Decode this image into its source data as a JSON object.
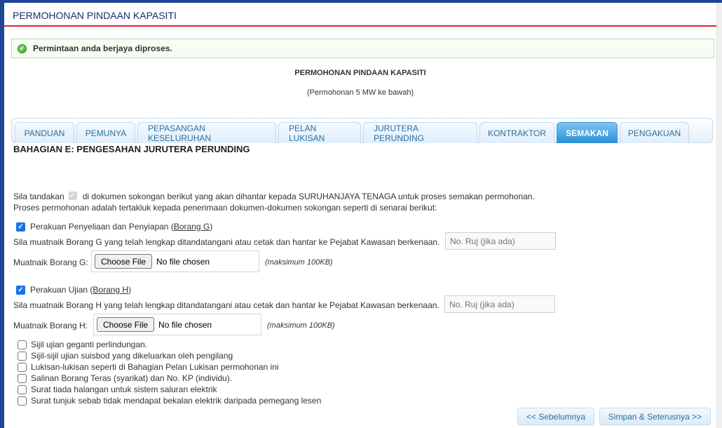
{
  "page": {
    "header_title": "PERMOHONAN PINDAAN KAPASITI"
  },
  "alert": {
    "icon": "success-check-icon",
    "message": "Permintaan anda berjaya diproses.",
    "color": "#3d9c2e"
  },
  "form": {
    "title": "PERMOHONAN PINDAAN KAPASITI",
    "subtitle": "(Permohonan 5 MW ke bawah)"
  },
  "tabs": [
    {
      "label": "PANDUAN",
      "active": false
    },
    {
      "label": "PEMUNYA",
      "active": false
    },
    {
      "label": "PEPASANGAN KESELURUHAN",
      "active": false
    },
    {
      "label": "PELAN LUKISAN",
      "active": false
    },
    {
      "label": "JURUTERA PERUNDING",
      "active": false
    },
    {
      "label": "KONTRAKTOR",
      "active": false
    },
    {
      "label": "SEMAKAN",
      "active": true
    },
    {
      "label": "PENGAKUAN",
      "active": false
    }
  ],
  "section": {
    "title": "BAHAGIAN E: PENGESAHAN JURUTERA PERUNDING",
    "intro_before": "Sila tandakan",
    "intro_after": "di dokumen sokongan berikut yang akan dihantar kepada SURUHANJAYA TENAGA untuk proses semakan permohonan.",
    "intro_line2": "Proses permohonan adalah tertakluk kepada penerimaan dokumen-dokumen sokongan seperti di senarai berikut:"
  },
  "borang_g": {
    "checked": true,
    "label_before": "Perakuan Penyeliaan dan Penyiapan (",
    "link": "Borang G",
    "label_after": ")",
    "instruction": "Sila muatnaik Borang G yang telah lengkap ditandatangani atau cetak dan hantar ke Pejabat Kawasan berkenaan.",
    "ruj_placeholder": "No. Ruj (jika ada)",
    "ruj_value": "",
    "upload_label": "Muatnaik Borang G:",
    "file_button": "Choose File",
    "file_status": "No file chosen",
    "max_note": "(maksimum 100KB)"
  },
  "borang_h": {
    "checked": true,
    "label_before": "Perakuan Ujian (",
    "link": "Borang H",
    "label_after": ")",
    "instruction": "Sila muatnaik Borang H yang telah lengkap ditandatangani atau cetak dan hantar ke Pejabat Kawasan berkenaan.",
    "ruj_placeholder": "No. Ruj (jika ada)",
    "ruj_value": "",
    "upload_label": "Muatnaik Borang H:",
    "file_button": "Choose File",
    "file_status": "No file chosen",
    "max_note": "(maksimum 100KB)"
  },
  "documents": [
    {
      "label": "Sijil ujian geganti perlindungan.",
      "checked": false
    },
    {
      "label": "Sijil-sijil ujian suisbod yang dikeluarkan oleh pengilang",
      "checked": false
    },
    {
      "label": "Lukisan-lukisan seperti di Bahagian Pelan Lukisan permohonan ini",
      "checked": false
    },
    {
      "label": "Salinan Borang Teras (syarikat) dan No. KP (individu).",
      "checked": false
    },
    {
      "label": "Surat tiada halangan untuk sistem saluran elektrik",
      "checked": false
    },
    {
      "label": "Surat tunjuk sebab tidak mendapat bekalan elektrik daripada pemegang lesen",
      "checked": false
    }
  ],
  "buttons": {
    "previous": "<< Sebelumnya",
    "save_next": "Simpan & Seterusnya >>"
  },
  "colors": {
    "brand_blue": "#1f4596",
    "header_underline": "#e0202a",
    "active_tab": "#2a8fd6",
    "tab_text": "#2e6e9e",
    "checkbox_checked": "#1a73e8"
  }
}
